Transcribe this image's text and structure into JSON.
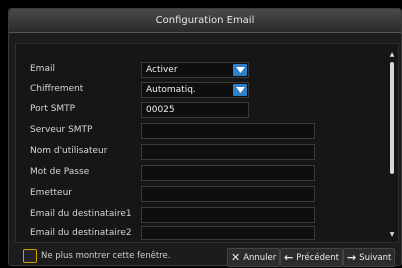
{
  "window": {
    "title": "Configuration Email"
  },
  "form": {
    "email": {
      "label": "Email",
      "value": "Activer"
    },
    "encryption": {
      "label": "Chiffrement",
      "value": "Automatiq."
    },
    "smtp_port": {
      "label": "Port SMTP",
      "value": "00025"
    },
    "smtp_server": {
      "label": "Serveur SMTP",
      "value": ""
    },
    "username": {
      "label": "Nom d'utilisateur",
      "value": ""
    },
    "password": {
      "label": "Mot de Passe",
      "value": ""
    },
    "sender": {
      "label": "Emetteur",
      "value": ""
    },
    "recipient1": {
      "label": "Email du destinataire1",
      "value": ""
    },
    "recipient2": {
      "label": "Email du destinataire2",
      "value": ""
    }
  },
  "footer": {
    "dont_show_label": "Ne plus montrer cette fenêtre.",
    "cancel_label": "Annuler",
    "previous_label": "Précédent",
    "next_label": "Suivant"
  },
  "colors": {
    "accent": "#2f7fc9",
    "checkbox_border": "#c9a400"
  },
  "icons": {
    "dropdown": "chevron-down-icon",
    "cancel": "close-icon",
    "previous": "arrow-left-icon",
    "next": "arrow-right-icon"
  }
}
